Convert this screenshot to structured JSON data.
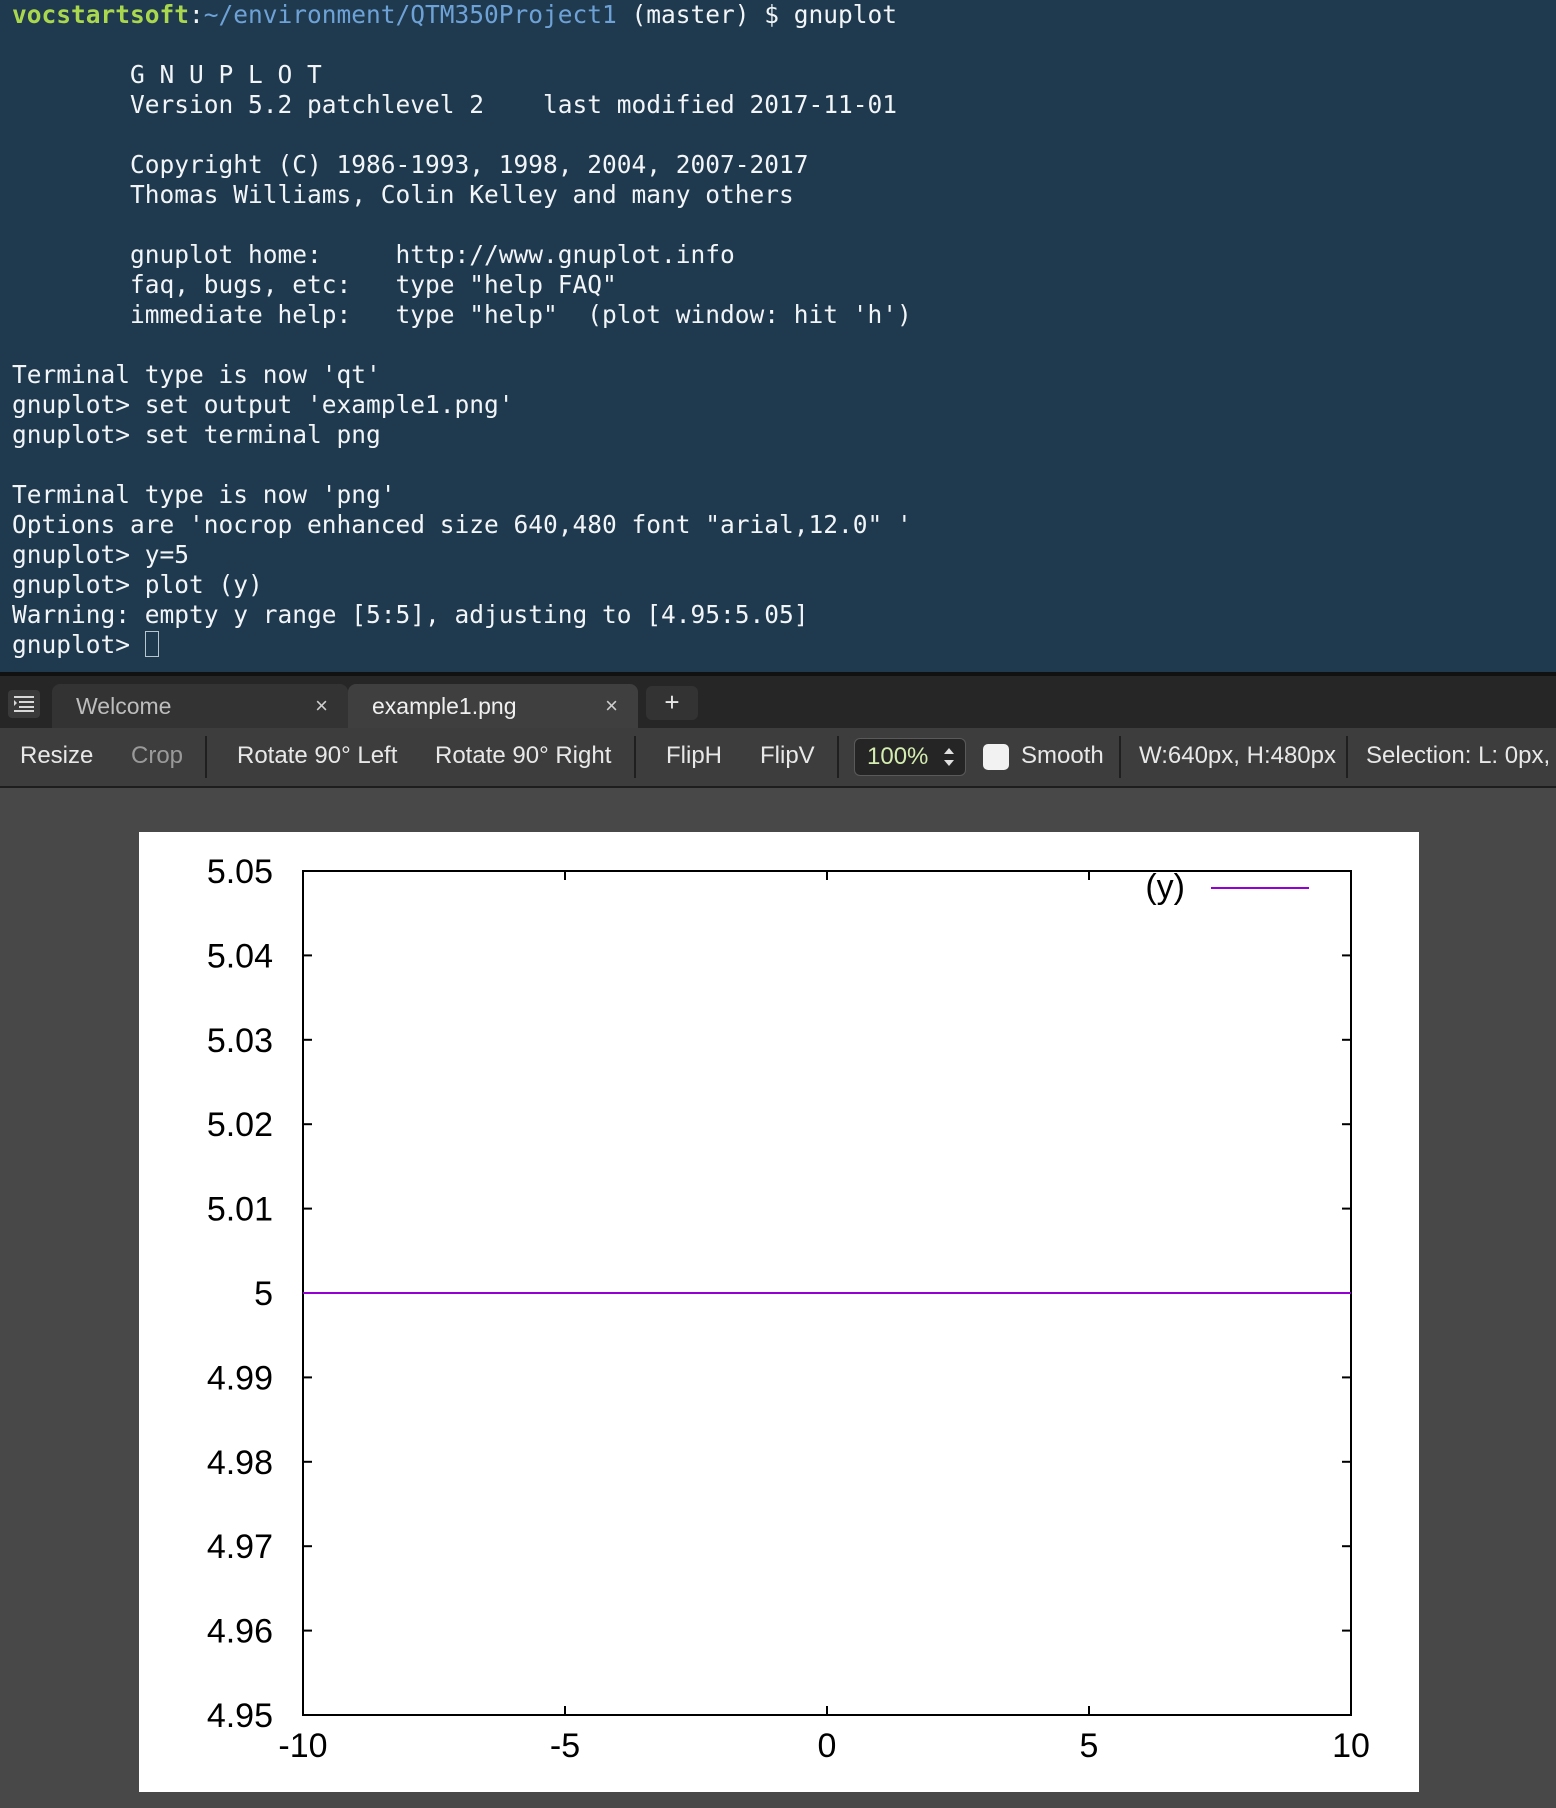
{
  "terminal": {
    "lines": [
      {
        "user": "vocstartsoft",
        "sep": ":",
        "path": "~/environment/QTM350Project1",
        "rest": " (master) $ gnuplot"
      },
      {
        "text": ""
      },
      {
        "text": "        G N U P L O T"
      },
      {
        "text": "        Version 5.2 patchlevel 2    last modified 2017-11-01"
      },
      {
        "text": ""
      },
      {
        "text": "        Copyright (C) 1986-1993, 1998, 2004, 2007-2017"
      },
      {
        "text": "        Thomas Williams, Colin Kelley and many others"
      },
      {
        "text": ""
      },
      {
        "text": "        gnuplot home:     http://www.gnuplot.info"
      },
      {
        "text": "        faq, bugs, etc:   type \"help FAQ\""
      },
      {
        "text": "        immediate help:   type \"help\"  (plot window: hit 'h')"
      },
      {
        "text": ""
      },
      {
        "text": "Terminal type is now 'qt'"
      },
      {
        "text": "gnuplot> set output 'example1.png'"
      },
      {
        "text": "gnuplot> set terminal png"
      },
      {
        "text": ""
      },
      {
        "text": "Terminal type is now 'png'"
      },
      {
        "text": "Options are 'nocrop enhanced size 640,480 font \"arial,12.0\" '"
      },
      {
        "text": "gnuplot> y=5"
      },
      {
        "text": "gnuplot> plot (y)"
      },
      {
        "text": "Warning: empty y range [5:5], adjusting to [4.95:5.05]"
      },
      {
        "prompt": "gnuplot> ",
        "cursor": true
      }
    ]
  },
  "tabs": [
    {
      "label": "Welcome",
      "close": "×",
      "active": false
    },
    {
      "label": "example1.png",
      "close": "×",
      "active": true
    }
  ],
  "new_tab_label": "+",
  "toolbar": {
    "resize": "Resize",
    "crop": "Crop",
    "rotate_left": "Rotate 90° Left",
    "rotate_right": "Rotate 90° Right",
    "fliph": "FlipH",
    "flipv": "FlipV",
    "zoom": "100%",
    "smooth": "Smooth",
    "smooth_checked": false,
    "dimensions": "W:640px, H:480px",
    "selection": "Selection:  L: 0px,"
  },
  "icons": {
    "tab_list": "list-icon",
    "zoom_spinner": "up-down-arrows-icon",
    "tab_close": "close-icon"
  },
  "colors": {
    "terminal_bg": "#1f3a4f",
    "prompt_user": "#a9d84e",
    "prompt_path": "#6ea2d7",
    "series_line": "#9400d3"
  },
  "chart_data": {
    "type": "line",
    "x": [
      -10,
      10
    ],
    "series": [
      {
        "name": "(y)",
        "values": [
          5,
          5
        ]
      }
    ],
    "xlim": [
      -10,
      10
    ],
    "ylim": [
      4.95,
      5.05
    ],
    "x_ticks": [
      "-10",
      "-5",
      "0",
      "5",
      "10"
    ],
    "y_ticks": [
      "4.95",
      "4.96",
      "4.97",
      "4.98",
      "4.99",
      "5",
      "5.01",
      "5.02",
      "5.03",
      "5.04",
      "5.05"
    ],
    "x_tick_values": [
      -10,
      -5,
      0,
      5,
      10
    ],
    "y_tick_values": [
      4.95,
      4.96,
      4.97,
      4.98,
      4.99,
      5,
      5.01,
      5.02,
      5.03,
      5.04,
      5.05
    ],
    "legend_position": "top-right",
    "title": "",
    "xlabel": "",
    "ylabel": "",
    "grid": false
  }
}
